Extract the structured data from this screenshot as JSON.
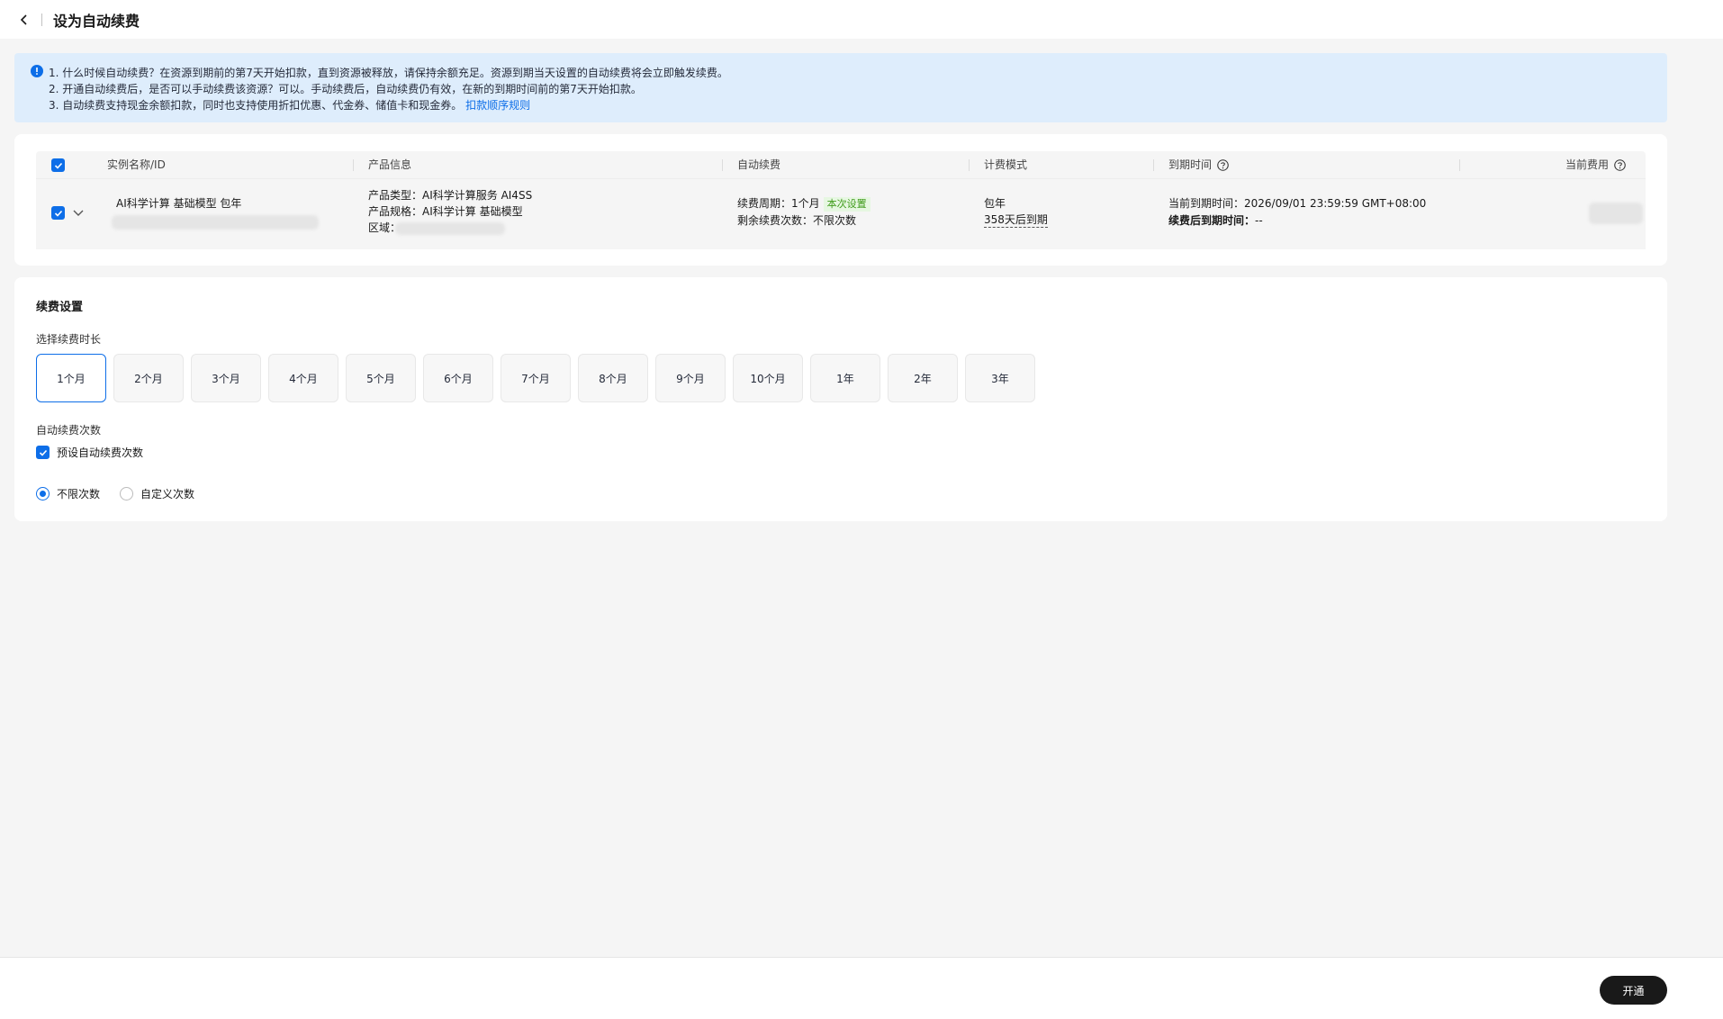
{
  "header": {
    "title": "设为自动续费",
    "back_icon": "chevron-left-icon"
  },
  "notice": {
    "icon": "info-icon",
    "lines": [
      "1. 什么时候自动续费？在资源到期前的第7天开始扣款，直到资源被释放，请保持余额充足。资源到期当天设置的自动续费将会立即触发续费。",
      "2. 开通自动续费后，是否可以手动续费该资源？可以。手动续费后，自动续费仍有效，在新的到期时间前的第7天开始扣款。",
      "3. 自动续费支持现金余额扣款，同时也支持使用折扣优惠、代金券、储值卡和现金券。"
    ],
    "link": "扣款顺序规则"
  },
  "table": {
    "columns": [
      "实例名称/ID",
      "产品信息",
      "自动续费",
      "计费模式",
      "到期时间",
      "当前费用"
    ],
    "row": {
      "name": "AI科学计算 基础模型 包年",
      "product_type": "产品类型：AI科学计算服务 AI4SS",
      "product_spec": "产品规格：AI科学计算 基础模型",
      "region_label": "区域：",
      "renew_period": "续费周期：1个月",
      "renew_tag": "本次设置",
      "renew_remaining": "剩余续费次数：不限次数",
      "billing_mode": "包年",
      "billing_expire": "358天后到期",
      "current_expire": "当前到期时间：2026/09/01 23:59:59 GMT+08:00",
      "after_label": "续费后到期时间：",
      "after_value": "--"
    }
  },
  "settings": {
    "title": "续费设置",
    "duration_label": "选择续费时长",
    "durations": [
      "1个月",
      "2个月",
      "3个月",
      "4个月",
      "5个月",
      "6个月",
      "7个月",
      "8个月",
      "9个月",
      "10个月",
      "1年",
      "2年",
      "3年"
    ],
    "selected_duration": "1个月",
    "count_label": "自动续费次数",
    "preset_checkbox": "预设自动续费次数",
    "radio_unlimited": "不限次数",
    "radio_custom": "自定义次数"
  },
  "footer": {
    "submit": "开通"
  },
  "colors": {
    "primary": "#0d6ee8",
    "notice_bg": "#deedfc",
    "tag_bg": "#e6f7e1",
    "tag_fg": "#3f9b1a",
    "button_bg": "#191919"
  }
}
